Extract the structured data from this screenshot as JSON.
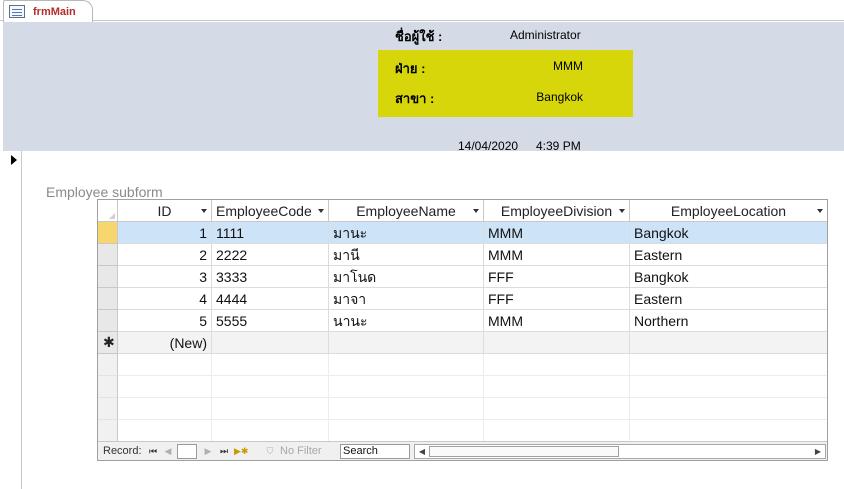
{
  "tab": {
    "label": "frmMain",
    "icon": "form-icon"
  },
  "header": {
    "user_label": "ชื่อผู้ใช้ :",
    "user_value": "Administrator",
    "division_label": "ฝ่าย :",
    "division_value": "MMM",
    "branch_label": "สาขา :",
    "branch_value": "Bangkok",
    "date": "14/04/2020",
    "time": "4:39 PM"
  },
  "colors": {
    "header_bg": "#d4dbe7",
    "division_box": "#d6d60a",
    "tab_text": "#b52a2a",
    "selected_row": "#cde3f7",
    "selector_active": "#f7d66d"
  },
  "subform": {
    "label": "Employee subform"
  },
  "table": {
    "columns": [
      "ID",
      "EmployeeCode",
      "EmployeeName",
      "EmployeeDivision",
      "EmployeeLocation"
    ],
    "rows": [
      [
        "1",
        "1111",
        "มานะ",
        "MMM",
        "Bangkok"
      ],
      [
        "2",
        "2222",
        "มานี",
        "MMM",
        "Eastern"
      ],
      [
        "3",
        "3333",
        "มาโนด",
        "FFF",
        "Bangkok"
      ],
      [
        "4",
        "4444",
        "มาจา",
        "FFF",
        "Eastern"
      ],
      [
        "5",
        "5555",
        "นานะ",
        "MMM",
        "Northern"
      ]
    ],
    "new_row": "(New)"
  },
  "navbar": {
    "record_label": "Record:",
    "current": "",
    "filter_label": "No Filter",
    "search_label": "Search"
  }
}
